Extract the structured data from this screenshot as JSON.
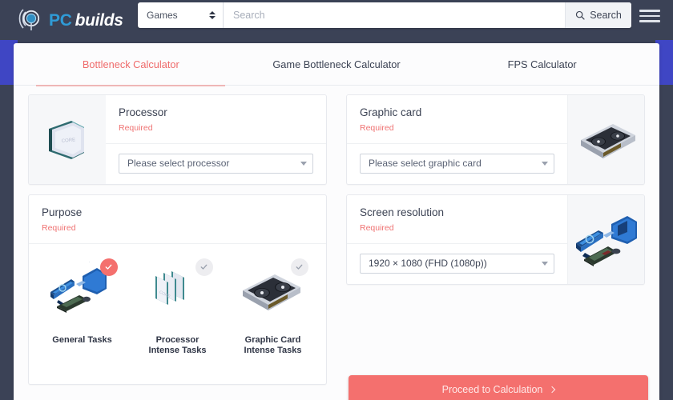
{
  "header": {
    "logo_icon": "pcbuilds-logo-icon",
    "brand_pc": "PC",
    "brand_builds": "builds",
    "category_value": "Games",
    "category_icon": "updown-spinner-icon",
    "search_placeholder": "Search",
    "search_value": "",
    "search_button_label": "Search",
    "search_button_icon": "search-icon",
    "menu_icon": "hamburger-menu-icon"
  },
  "tabs": [
    {
      "label": "Bottleneck Calculator",
      "active": true
    },
    {
      "label": "Game Bottleneck Calculator",
      "active": false
    },
    {
      "label": "FPS Calculator",
      "active": false
    }
  ],
  "processor": {
    "title": "Processor",
    "required": "Required",
    "select_value": "Please select processor",
    "image_icon": "cpu-chip-icon",
    "caret_icon": "chevron-down-icon"
  },
  "graphic_card": {
    "title": "Graphic card",
    "required": "Required",
    "select_value": "Please select graphic card",
    "image_icon": "gpu-card-icon",
    "caret_icon": "chevron-down-icon"
  },
  "purpose": {
    "title": "Purpose",
    "required": "Required",
    "options": [
      {
        "label": "General Tasks",
        "selected": true,
        "icon": "desktop-setup-icon",
        "check_icon": "check-icon"
      },
      {
        "label": "Processor\nIntense Tasks",
        "label_line1": "Processor",
        "label_line2": "Intense Tasks",
        "selected": false,
        "icon": "cpu-stack-icon",
        "check_icon": "check-icon"
      },
      {
        "label": "Graphic Card\nIntense Tasks",
        "label_line1": "Graphic Card",
        "label_line2": "Intense Tasks",
        "selected": false,
        "icon": "gpu-card-icon",
        "check_icon": "check-icon"
      }
    ]
  },
  "screen_resolution": {
    "title": "Screen resolution",
    "required": "Required",
    "select_value": "1920 × 1080 (FHD (1080p))",
    "image_icon": "monitor-pc-setup-icon",
    "caret_icon": "chevron-down-icon"
  },
  "footer": {
    "proceed_label": "Proceed to Calculation",
    "proceed_icon": "chevron-right-icon"
  },
  "colors": {
    "header_bg": "#3b4256",
    "accent_strip": "#3f46c4",
    "primary_red": "#f4706e",
    "tab_active": "#ef6b6b",
    "required_red": "#ef7272",
    "brand_blue": "#2f9bd6",
    "panel_bg": "#fcfcfd"
  }
}
